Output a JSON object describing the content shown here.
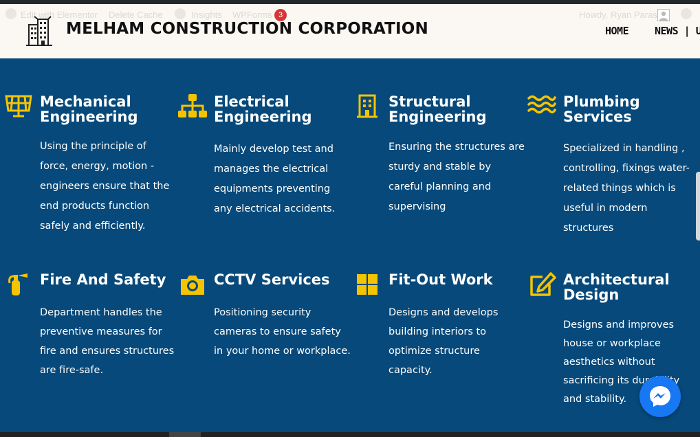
{
  "admin_bar": {
    "items": [
      "Edit with Elementor",
      "Delete Cache",
      "Insights",
      "WPForms"
    ],
    "wpforms_count": "3",
    "greeting": "Howdy, Ryan Paras"
  },
  "header": {
    "brand": "MELHAM CONSTRUCTION CORPORATION",
    "nav": {
      "home": "HOME",
      "news": "NEWS | UI"
    }
  },
  "colors": {
    "primary_bg": "#07497a",
    "accent": "#f5c400",
    "header_bg": "#fbf8f3",
    "messenger": "#1877f2"
  },
  "services": [
    {
      "icon": "solar-panel-icon",
      "title": "Mechanical Engineering",
      "description": "Using the principle of force, energy, motion - engineers ensure that the end products function safely and efficiently."
    },
    {
      "icon": "sitemap-icon",
      "title": "Electrical Engineering",
      "description": "Mainly develop test and manages the electrical equipments preventing any electrical accidents."
    },
    {
      "icon": "building-icon",
      "title": "Structural Engineering",
      "description": "Ensuring the structures are sturdy and stable by careful planning and supervising"
    },
    {
      "icon": "water-icon",
      "title": "Plumbing Services",
      "description": "Specialized in handling , controlling, fixings water-related things which is useful in modern structures"
    },
    {
      "icon": "fire-extinguisher-icon",
      "title": "Fire And Safety",
      "description": "Department handles the preventive measures for fire and ensures structures are fire-safe."
    },
    {
      "icon": "camera-icon",
      "title": "CCTV Services",
      "description": "Positioning security cameras to ensure safety in your home or workplace."
    },
    {
      "icon": "grid-icon",
      "title": "Fit-Out Work",
      "description": "Designs and develops building interiors to optimize structure capacity."
    },
    {
      "icon": "edit-icon",
      "title": "Architectural Design",
      "description": "Designs and improves house or workplace aesthetics without sacrificing its durability and stability."
    }
  ]
}
